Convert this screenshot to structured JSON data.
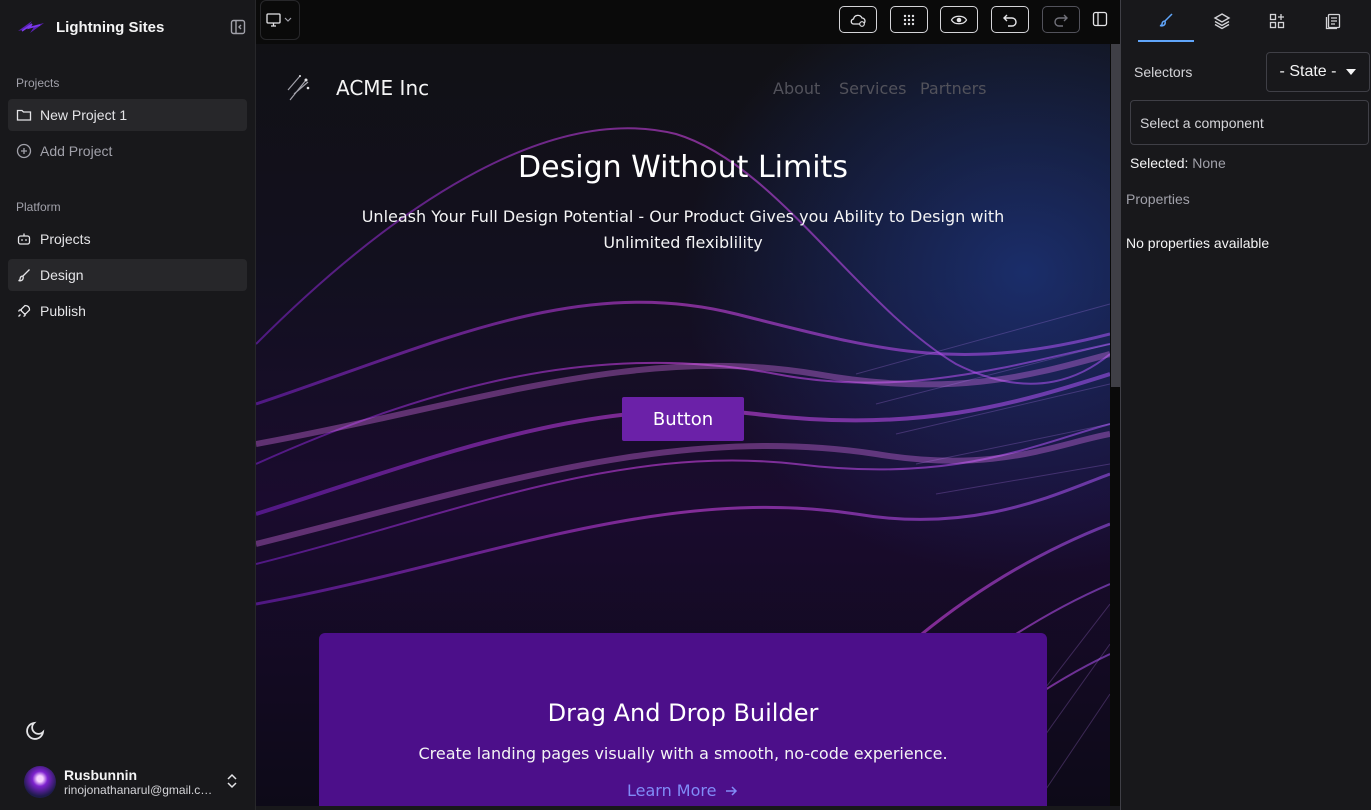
{
  "sidebar": {
    "brand": "Lightning Sites",
    "projects_label": "Projects",
    "project_items": [
      {
        "label": "New Project 1"
      },
      {
        "label": "Add Project"
      }
    ],
    "platform_label": "Platform",
    "platform_items": [
      {
        "label": "Projects"
      },
      {
        "label": "Design"
      },
      {
        "label": "Publish"
      }
    ],
    "user": {
      "name": "Rusbunnin",
      "email": "rinojonathanarul@gmail.com"
    }
  },
  "site": {
    "name": "ACME Inc",
    "nav": [
      "About",
      "Services",
      "Partners"
    ],
    "hero_title": "Design Without Limits",
    "hero_subtitle": "Unleash Your Full Design Potential -  Our Product Gives you Ability to Design with Unlimited flexiblility",
    "button": "Button",
    "feature": {
      "title": "Drag And Drop Builder",
      "description": "Create landing pages visually with a smooth, no-code experience.",
      "link": "Learn More"
    }
  },
  "right_panel": {
    "selectors_label": "Selectors",
    "state_value": "- State -",
    "component_placeholder": "Select a component",
    "selected_label": "Selected:",
    "selected_value": "None",
    "properties_label": "Properties",
    "no_properties": "No properties available"
  },
  "colors": {
    "accent": "#6b21a8",
    "card": "#4c0f8a",
    "link": "#818cf8",
    "active_tab": "#60a5fa"
  }
}
